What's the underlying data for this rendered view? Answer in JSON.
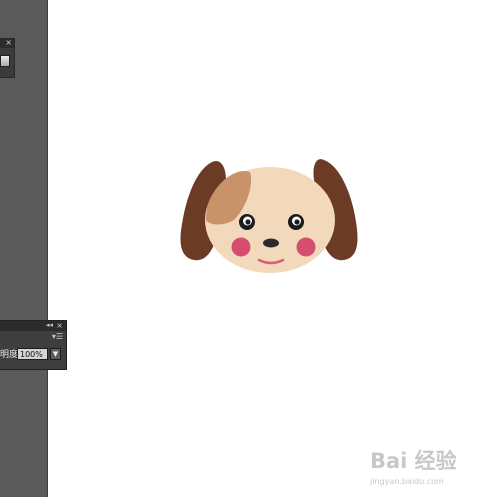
{
  "panels": {
    "top": {
      "close_glyph": "×"
    },
    "bottom": {
      "collapse_glyph": "◂◂",
      "close_glyph": "×",
      "menu_glyph": "▾☰",
      "opacity_label": "明度:",
      "opacity_value": "100%",
      "dropdown_glyph": "▼"
    }
  },
  "artwork": {
    "subject": "puppy-face-illustration",
    "colors": {
      "ears": "#6b3b26",
      "face": "#f2d9bb",
      "patch": "#c9936a",
      "eyes": "#1b1b1b",
      "cheeks": "#d64e6f",
      "mouth": "#e05a7c",
      "nose": "#2a2a2a"
    }
  },
  "watermark": {
    "brand": "Bai 经验",
    "url": "jingyan.baidu.com"
  }
}
